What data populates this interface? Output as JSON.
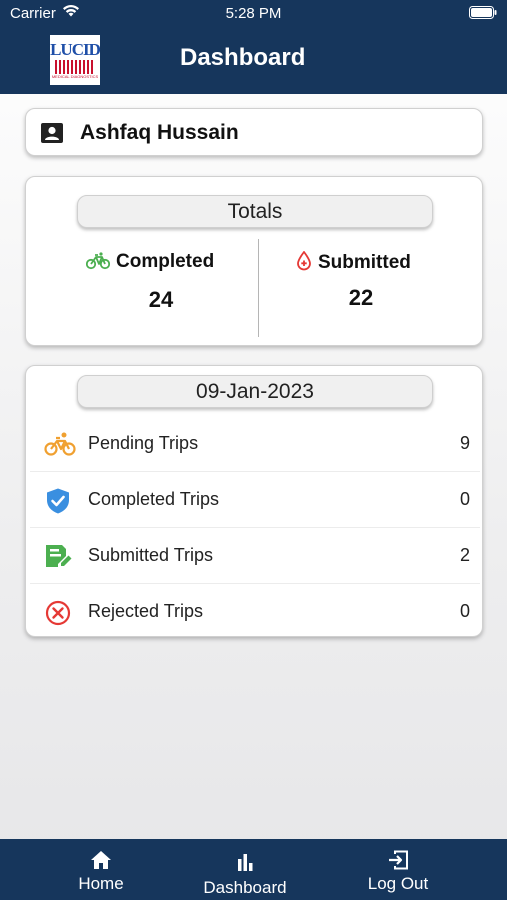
{
  "status_bar": {
    "carrier": "Carrier",
    "time": "5:28 PM"
  },
  "header": {
    "logo_text": "LUCID",
    "logo_subtext": "MEDICAL DIAGNOSTICS",
    "title": "Dashboard"
  },
  "user": {
    "name": "Ashfaq Hussain",
    "icon": "user-card-icon"
  },
  "totals": {
    "title": "Totals",
    "completed_label": "Completed",
    "completed_value": "24",
    "completed_icon": "bicycle-icon",
    "submitted_label": "Submitted",
    "submitted_value": "22",
    "submitted_icon": "blood-drop-icon"
  },
  "daily": {
    "date": "09-Jan-2023",
    "rows": [
      {
        "label": "Pending Trips",
        "count": "9",
        "icon": "bicycle-icon",
        "color": "#f0a030"
      },
      {
        "label": "Completed Trips",
        "count": "0",
        "icon": "shield-check-icon",
        "color": "#3a8fe0"
      },
      {
        "label": "Submitted Trips",
        "count": "2",
        "icon": "document-edit-icon",
        "color": "#4caf50"
      },
      {
        "label": "Rejected Trips",
        "count": "0",
        "icon": "circle-x-icon",
        "color": "#e53935"
      }
    ]
  },
  "tabbar": {
    "home": "Home",
    "dashboard": "Dashboard",
    "logout": "Log Out"
  },
  "colors": {
    "brand": "#16365c",
    "completed_green": "#4caf50",
    "submitted_red": "#e53935"
  }
}
